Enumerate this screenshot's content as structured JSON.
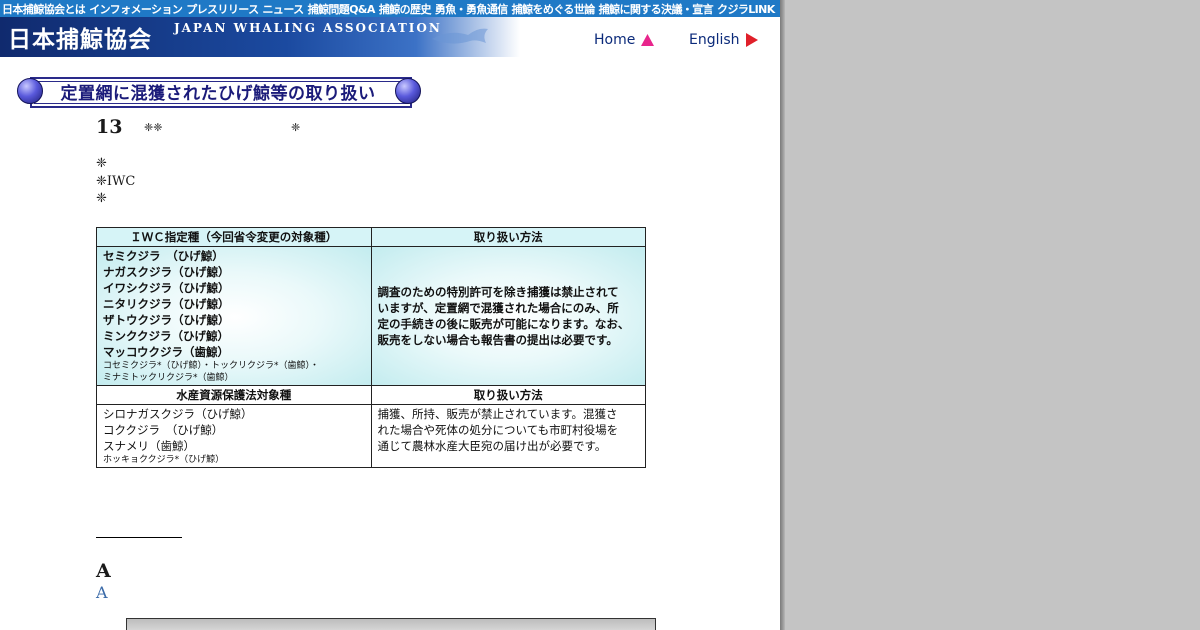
{
  "topnav": [
    "日本捕鯨協会とは",
    "インフォメーション",
    "プレスリリース",
    "ニュース",
    "捕鯨問題Q&A",
    "捕鯨の歴史",
    "勇魚・勇魚通信",
    "捕鯨をめぐる世論",
    "捕鯨に関する決議・宣言",
    "クジラLINK"
  ],
  "header": {
    "logo_jp": "日本捕鯨協会",
    "logo_en": "JAPAN WHALING ASSOCIATION",
    "home_label": "Home",
    "english_label": "English",
    "accent_pink": "#e8258c",
    "accent_red": "#e0202a"
  },
  "section_title": "定置網に混獲されたひげ鯨等の取り扱い",
  "notes": {
    "number": "13",
    "marks1": "❈❈",
    "marks2": "❈",
    "line1": "❈",
    "line2": "❈IWC",
    "line3": "❈"
  },
  "table": {
    "section1": {
      "col1_header": "ＩＷＣ指定種（今回省令変更の対象種）",
      "col2_header": "取り扱い方法",
      "species": [
        "セミクジラ　（ひげ鯨）",
        "ナガスクジラ（ひげ鯨）",
        "イワシクジラ（ひげ鯨）",
        "ニタリクジラ（ひげ鯨）",
        "ザトウクジラ（ひげ鯨）",
        "ミンククジラ（ひげ鯨）",
        "マッコウクジラ（歯鯨）"
      ],
      "small_species": [
        "コセミクジラ*（ひげ鯨）・トックリクジラ*（歯鯨）・",
        "ミナミトックリクジラ*（歯鯨）"
      ],
      "method_lines": [
        "調査のための特別許可を除き捕獲は禁止されて",
        "いますが、定置網で混獲された場合にのみ、所",
        "定の手続きの後に販売が可能になります。なお、",
        "販売をしない場合も報告書の提出は必要です。"
      ]
    },
    "section2": {
      "col1_header": "水産資源保護法対象種",
      "col2_header": "取り扱い方法",
      "species": [
        "シロナガスクジラ（ひげ鯨）",
        "コククジラ　（ひげ鯨）",
        "スナメリ（歯鯨）"
      ],
      "small_species": [
        "ホッキョククジラ*（ひげ鯨）"
      ],
      "method_lines": [
        "捕獲、所持、販売が禁止されています。混獲さ",
        "れた場合や死体の処分についても市町村役場を",
        "通じて農林水産大臣宛の届け出が必要です。"
      ]
    }
  },
  "footer": {
    "letter": "A",
    "link": "A"
  }
}
